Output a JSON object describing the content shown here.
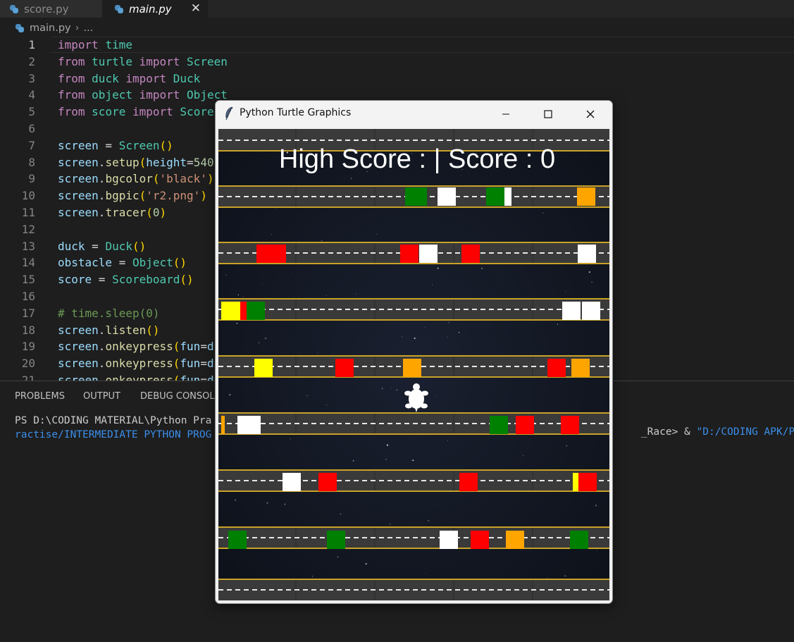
{
  "tabs": [
    {
      "label": "score.py",
      "icon": "python-icon",
      "active": false
    },
    {
      "label": "main.py",
      "icon": "python-icon",
      "active": true
    }
  ],
  "tab_close_glyph": "✕",
  "breadcrumb": {
    "file": "main.py",
    "separator": "›",
    "rest": "..."
  },
  "editor": {
    "lines": [
      {
        "n": "1",
        "segs": [
          [
            "kw",
            "import"
          ],
          [
            "op",
            " "
          ],
          [
            "mod",
            "time"
          ]
        ]
      },
      {
        "n": "2",
        "segs": [
          [
            "kw",
            "from"
          ],
          [
            "op",
            " "
          ],
          [
            "mod",
            "turtle"
          ],
          [
            "op",
            " "
          ],
          [
            "kw",
            "import"
          ],
          [
            "op",
            " "
          ],
          [
            "mod",
            "Screen"
          ]
        ]
      },
      {
        "n": "3",
        "segs": [
          [
            "kw",
            "from"
          ],
          [
            "op",
            " "
          ],
          [
            "mod",
            "duck"
          ],
          [
            "op",
            " "
          ],
          [
            "kw",
            "import"
          ],
          [
            "op",
            " "
          ],
          [
            "mod",
            "Duck"
          ]
        ]
      },
      {
        "n": "4",
        "segs": [
          [
            "kw",
            "from"
          ],
          [
            "op",
            " "
          ],
          [
            "mod",
            "object"
          ],
          [
            "op",
            " "
          ],
          [
            "kw",
            "import"
          ],
          [
            "op",
            " "
          ],
          [
            "mod",
            "Object"
          ]
        ]
      },
      {
        "n": "5",
        "segs": [
          [
            "kw",
            "from"
          ],
          [
            "op",
            " "
          ],
          [
            "mod",
            "score"
          ],
          [
            "op",
            " "
          ],
          [
            "kw",
            "import"
          ],
          [
            "op",
            " "
          ],
          [
            "mod",
            "Scoreboard"
          ]
        ]
      },
      {
        "n": "6",
        "segs": []
      },
      {
        "n": "7",
        "segs": [
          [
            "var",
            "screen"
          ],
          [
            "op",
            " = "
          ],
          [
            "mod",
            "Screen"
          ],
          [
            "pn",
            "()"
          ]
        ]
      },
      {
        "n": "8",
        "segs": [
          [
            "var",
            "screen"
          ],
          [
            "op",
            "."
          ],
          [
            "fn",
            "setup"
          ],
          [
            "pn",
            "("
          ],
          [
            "var",
            "height"
          ],
          [
            "op",
            "="
          ],
          [
            "num",
            "540"
          ]
        ]
      },
      {
        "n": "9",
        "segs": [
          [
            "var",
            "screen"
          ],
          [
            "op",
            "."
          ],
          [
            "fn",
            "bgcolor"
          ],
          [
            "pn",
            "("
          ],
          [
            "str",
            "'black'"
          ],
          [
            "pn",
            ")"
          ]
        ]
      },
      {
        "n": "10",
        "segs": [
          [
            "var",
            "screen"
          ],
          [
            "op",
            "."
          ],
          [
            "fn",
            "bgpic"
          ],
          [
            "pn",
            "("
          ],
          [
            "str",
            "'r2.png'"
          ],
          [
            "pn",
            ")"
          ]
        ]
      },
      {
        "n": "11",
        "segs": [
          [
            "var",
            "screen"
          ],
          [
            "op",
            "."
          ],
          [
            "fn",
            "tracer"
          ],
          [
            "pn",
            "("
          ],
          [
            "num",
            "0"
          ],
          [
            "pn",
            ")"
          ]
        ]
      },
      {
        "n": "12",
        "segs": []
      },
      {
        "n": "13",
        "segs": [
          [
            "var",
            "duck"
          ],
          [
            "op",
            " = "
          ],
          [
            "mod",
            "Duck"
          ],
          [
            "pn",
            "()"
          ]
        ]
      },
      {
        "n": "14",
        "segs": [
          [
            "var",
            "obstacle"
          ],
          [
            "op",
            " = "
          ],
          [
            "mod",
            "Object"
          ],
          [
            "pn",
            "()"
          ]
        ]
      },
      {
        "n": "15",
        "segs": [
          [
            "var",
            "score"
          ],
          [
            "op",
            " = "
          ],
          [
            "mod",
            "Scoreboard"
          ],
          [
            "pn",
            "()"
          ]
        ]
      },
      {
        "n": "16",
        "segs": []
      },
      {
        "n": "17",
        "segs": [
          [
            "cmt",
            "# time.sleep(0)"
          ]
        ]
      },
      {
        "n": "18",
        "segs": [
          [
            "var",
            "screen"
          ],
          [
            "op",
            "."
          ],
          [
            "fn",
            "listen"
          ],
          [
            "pn",
            "()"
          ]
        ]
      },
      {
        "n": "19",
        "segs": [
          [
            "var",
            "screen"
          ],
          [
            "op",
            "."
          ],
          [
            "fn",
            "onkeypress"
          ],
          [
            "pn",
            "("
          ],
          [
            "var",
            "fun"
          ],
          [
            "op",
            "="
          ],
          [
            "var",
            "duck"
          ]
        ]
      },
      {
        "n": "20",
        "segs": [
          [
            "var",
            "screen"
          ],
          [
            "op",
            "."
          ],
          [
            "fn",
            "onkeypress"
          ],
          [
            "pn",
            "("
          ],
          [
            "var",
            "fun"
          ],
          [
            "op",
            "="
          ],
          [
            "var",
            "duck"
          ]
        ]
      },
      {
        "n": "21",
        "segs": [
          [
            "var",
            "screen"
          ],
          [
            "op",
            "."
          ],
          [
            "fn",
            "onkeypress"
          ],
          [
            "pn",
            "("
          ],
          [
            "var",
            "fun"
          ],
          [
            "op",
            "="
          ],
          [
            "var",
            "duck"
          ]
        ]
      }
    ]
  },
  "panel": {
    "tabs": [
      "PROBLEMS",
      "OUTPUT",
      "DEBUG CONSOLE"
    ],
    "terminal_line1_prefix": "PS D:\\CODING MATERIAL\\Python Pra",
    "terminal_line1_suffix_plain": "_Race> & ",
    "terminal_line1_suffix_path": "\"D:/CODING APK/PYTHO",
    "terminal_line2": "ractise/INTERMEDIATE PYTHON PROG"
  },
  "turtle_window": {
    "title": "Python Turtle Graphics",
    "hud_text": "High Score :  | Score : 0",
    "colors": {
      "green": "#008000",
      "white": "#ffffff",
      "orange": "#ffa500",
      "red": "#ff0000",
      "yellow": "#ffff00"
    }
  }
}
